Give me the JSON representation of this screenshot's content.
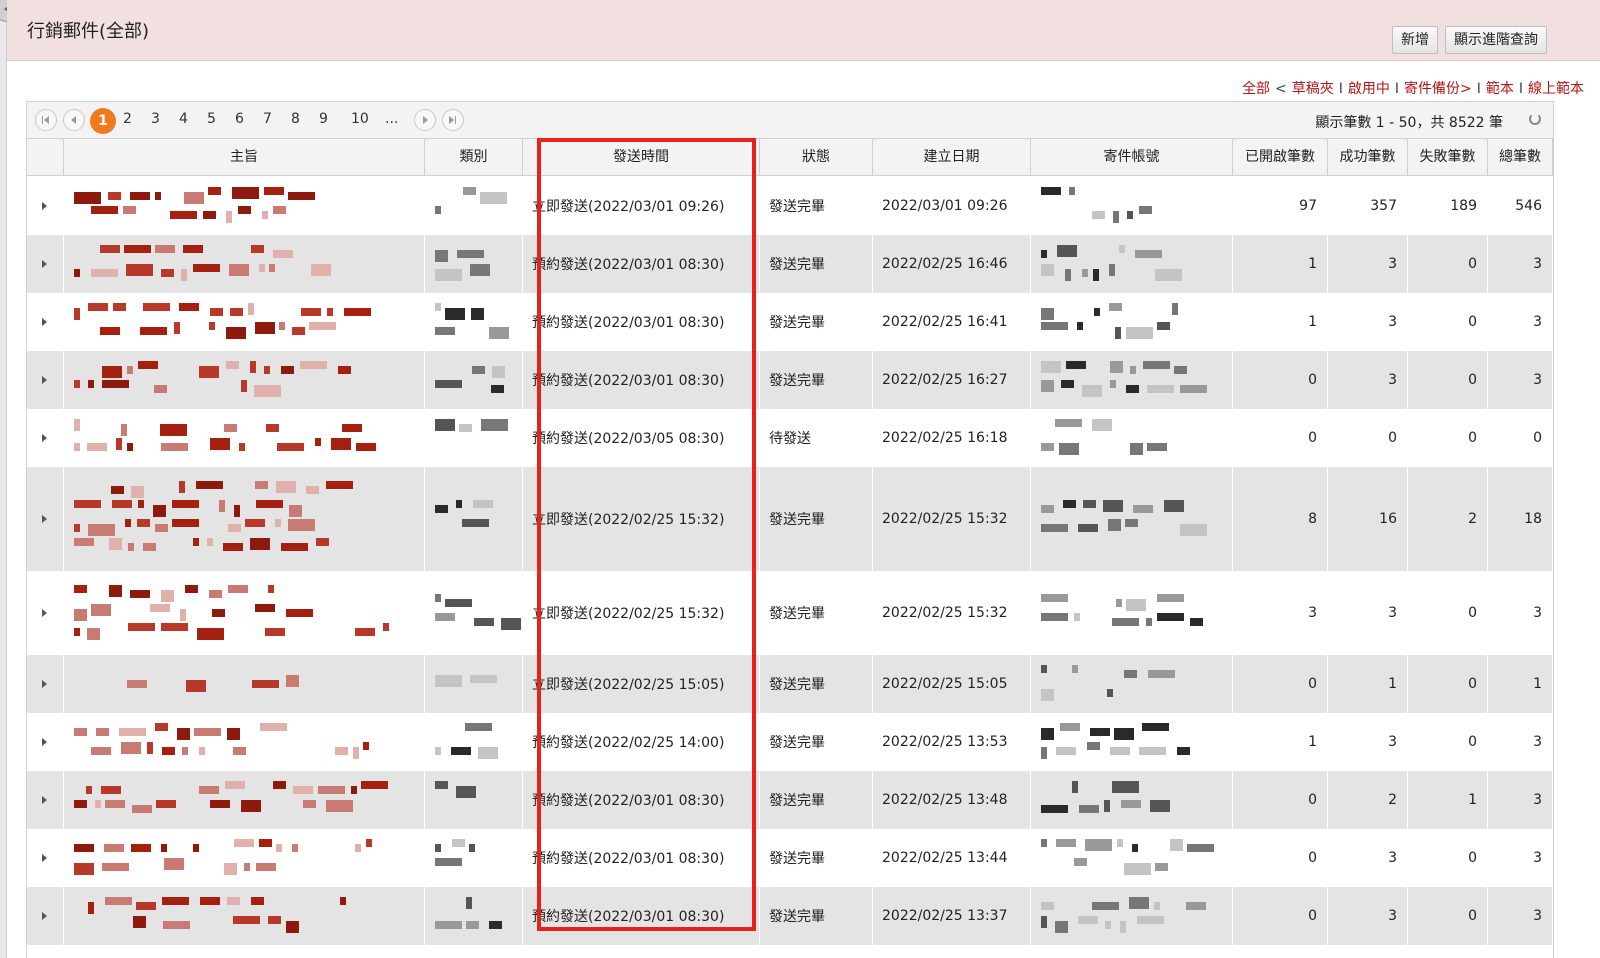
{
  "window": {
    "title": "行銷郵件(全部)"
  },
  "header": {
    "add_button": "新增",
    "advanced_search_button": "顯示進階查詢"
  },
  "filters": [
    {
      "label": "全部",
      "sep": "<"
    },
    {
      "label": "草稿夾",
      "sep": "I"
    },
    {
      "label": "啟用中",
      "sep": "I"
    },
    {
      "label": "寄件備份>",
      "sep": "I"
    },
    {
      "label": "範本",
      "sep": "I"
    },
    {
      "label": "線上範本",
      "sep": ""
    }
  ],
  "pager": {
    "pages": [
      "1",
      "2",
      "3",
      "4",
      "5",
      "6",
      "7",
      "8",
      "9",
      "10",
      "..."
    ],
    "current_page": "1",
    "info": "顯示筆數 1 - 50，共 8522 筆"
  },
  "table": {
    "columns": [
      "主旨",
      "類別",
      "發送時間",
      "狀態",
      "建立日期",
      "寄件帳號",
      "已開啟筆數",
      "成功筆數",
      "失敗筆數",
      "總筆數"
    ],
    "rows": [
      {
        "send_time": "立即發送(2022/03/01 09:26)",
        "status": "發送完畢",
        "created": "2022/03/01 09:26",
        "opened": "97",
        "success": "357",
        "failed": "189",
        "total": "546"
      },
      {
        "send_time": "預約發送(2022/03/01 08:30)",
        "status": "發送完畢",
        "created": "2022/02/25 16:46",
        "opened": "1",
        "success": "3",
        "failed": "0",
        "total": "3"
      },
      {
        "send_time": "預約發送(2022/03/01 08:30)",
        "status": "發送完畢",
        "created": "2022/02/25 16:41",
        "opened": "1",
        "success": "3",
        "failed": "0",
        "total": "3"
      },
      {
        "send_time": "預約發送(2022/03/01 08:30)",
        "status": "發送完畢",
        "created": "2022/02/25 16:27",
        "opened": "0",
        "success": "3",
        "failed": "0",
        "total": "3"
      },
      {
        "send_time": "預約發送(2022/03/05 08:30)",
        "status": "待發送",
        "created": "2022/02/25 16:18",
        "opened": "0",
        "success": "0",
        "failed": "0",
        "total": "0"
      },
      {
        "send_time": "立即發送(2022/02/25 15:32)",
        "status": "發送完畢",
        "created": "2022/02/25 15:32",
        "opened": "8",
        "success": "16",
        "failed": "2",
        "total": "18"
      },
      {
        "send_time": "立即發送(2022/02/25 15:32)",
        "status": "發送完畢",
        "created": "2022/02/25 15:32",
        "opened": "3",
        "success": "3",
        "failed": "0",
        "total": "3"
      },
      {
        "send_time": "立即發送(2022/02/25 15:05)",
        "status": "發送完畢",
        "created": "2022/02/25 15:05",
        "opened": "0",
        "success": "1",
        "failed": "0",
        "total": "1"
      },
      {
        "send_time": "預約發送(2022/02/25 14:00)",
        "status": "發送完畢",
        "created": "2022/02/25 13:53",
        "opened": "1",
        "success": "3",
        "failed": "0",
        "total": "3"
      },
      {
        "send_time": "預約發送(2022/03/01 08:30)",
        "status": "發送完畢",
        "created": "2022/02/25 13:48",
        "opened": "0",
        "success": "2",
        "failed": "1",
        "total": "3"
      },
      {
        "send_time": "預約發送(2022/03/01 08:30)",
        "status": "發送完畢",
        "created": "2022/02/25 13:44",
        "opened": "0",
        "success": "3",
        "failed": "0",
        "total": "3"
      },
      {
        "send_time": "預約發送(2022/03/01 08:30)",
        "status": "發送完畢",
        "created": "2022/02/25 13:37",
        "opened": "0",
        "success": "3",
        "failed": "0",
        "total": "3"
      }
    ]
  },
  "colors": {
    "accent": "#f07a1c",
    "link": "#b01818",
    "highlight": "#e8221b",
    "header_bg": "#f2dfe0",
    "redacted_red": "#a5200f",
    "redacted_dark": "#2a2a2a"
  }
}
